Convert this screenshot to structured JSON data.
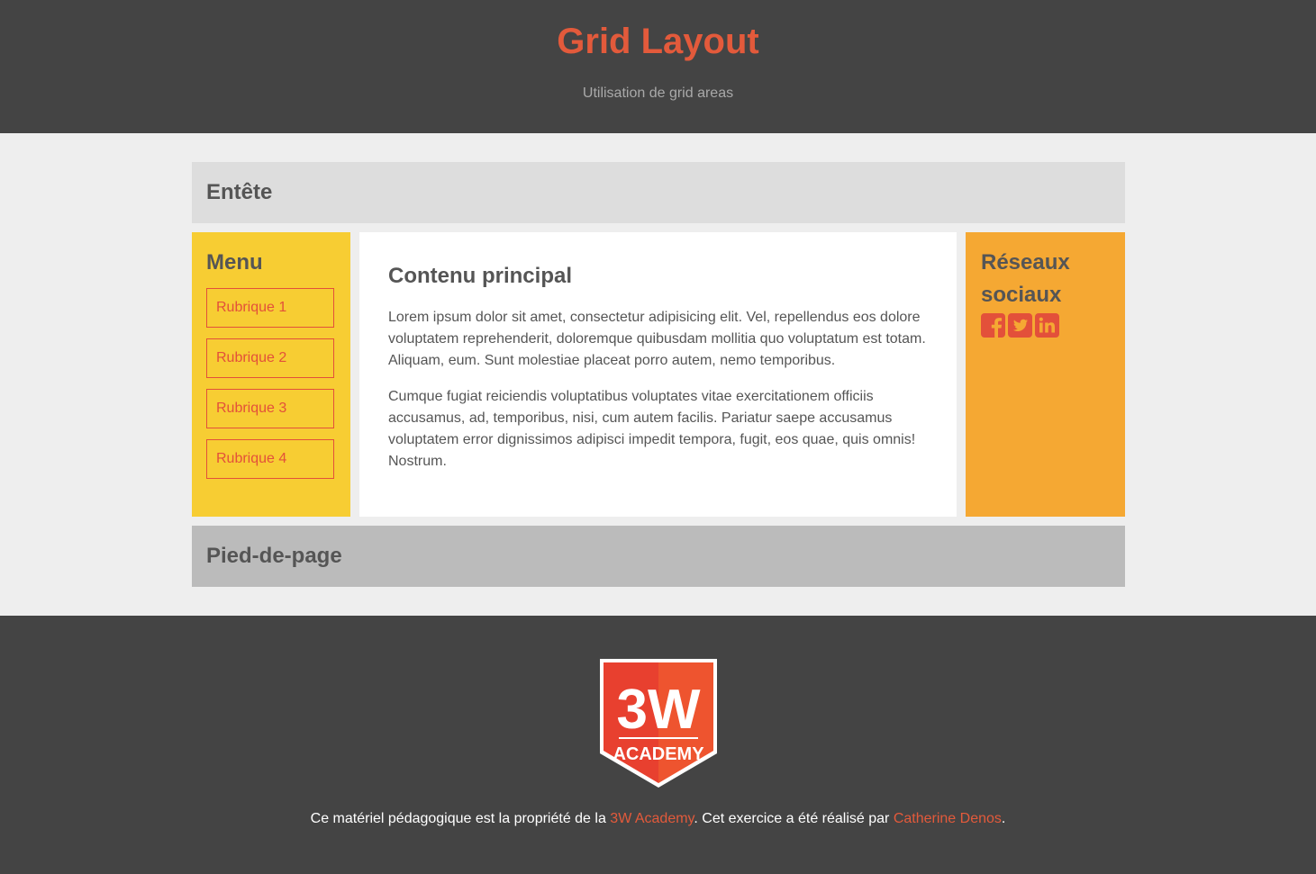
{
  "site_header": {
    "title": "Grid Layout",
    "subtitle": "Utilisation de grid areas"
  },
  "grid": {
    "header": {
      "title": "Entête"
    },
    "menu": {
      "title": "Menu",
      "items": [
        "Rubrique 1",
        "Rubrique 2",
        "Rubrique 3",
        "Rubrique 4"
      ]
    },
    "main": {
      "title": "Contenu principal",
      "paragraphs": [
        "Lorem ipsum dolor sit amet, consectetur adipisicing elit. Vel, repellendus eos dolore voluptatem reprehenderit, doloremque quibusdam mollitia quo voluptatum est totam. Aliquam, eum. Sunt molestiae placeat porro autem, nemo temporibus.",
        "Cumque fugiat reiciendis voluptatibus voluptates vitae exercitationem officiis accusamus, ad, temporibus, nisi, cum autem facilis. Pariatur saepe accusamus voluptatem error dignissimos adipisci impedit tempora, fugit, eos quae, quis omnis! Nostrum."
      ]
    },
    "social": {
      "title": "Réseaux sociaux",
      "icons": [
        "facebook-icon",
        "twitter-icon",
        "linkedin-icon"
      ]
    },
    "footer": {
      "title": "Pied-de-page"
    }
  },
  "site_footer": {
    "logo": {
      "main": "3W",
      "sub": "ACADEMY"
    },
    "text_before": "Ce matériel pédagogique est la propriété de la ",
    "link1": "3W Academy",
    "text_middle": ". Cet exercice a été réalisé par ",
    "link2": "Catherine Denos",
    "text_after": "."
  },
  "colors": {
    "dark_band": "#444444",
    "accent": "#e35a3b",
    "menu_bg": "#f7cd33",
    "social_bg": "#f5a833",
    "header_area_bg": "#dddddd",
    "footer_area_bg": "#bbbbbb",
    "page_bg": "#eeeeee"
  }
}
